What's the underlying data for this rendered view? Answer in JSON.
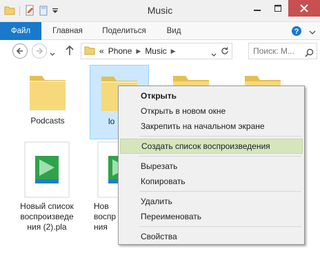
{
  "window": {
    "title": "Music",
    "colors": {
      "file_tab": "#1979ca",
      "close_button": "#c75050",
      "folder": "#f2d16b",
      "selection": "#cce8ff",
      "menu_highlight": "#d5e6bf"
    }
  },
  "ribbon": {
    "tabs": [
      "Файл",
      "Главная",
      "Поделиться",
      "Вид"
    ]
  },
  "address": {
    "overflow": "«",
    "crumbs": [
      "Phone",
      "Music"
    ],
    "search_placeholder": "Поиск: M..."
  },
  "items": [
    {
      "label": "Podcasts",
      "kind": "folder"
    },
    {
      "label": "lo",
      "kind": "folder"
    },
    {
      "label": "",
      "kind": "folder"
    },
    {
      "label": "",
      "kind": "folder"
    },
    {
      "label": "Новый список воспроизведе ния (2).pla",
      "lines": [
        "Новый список",
        "воспроизведе",
        "ния (2).pla"
      ],
      "kind": "playlist"
    },
    {
      "label": "Нов воспр ния",
      "lines": [
        "Нов",
        "воспр",
        "ния"
      ],
      "kind": "playlist"
    }
  ],
  "context_menu": {
    "group1": [
      "Открыть",
      "Открыть в новом окне",
      "Закрепить на начальном экране"
    ],
    "group2": [
      "Создать список воспроизведения"
    ],
    "group3": [
      "Вырезать",
      "Копировать"
    ],
    "group4": [
      "Удалить",
      "Переименовать"
    ],
    "group5": [
      "Свойства"
    ]
  }
}
